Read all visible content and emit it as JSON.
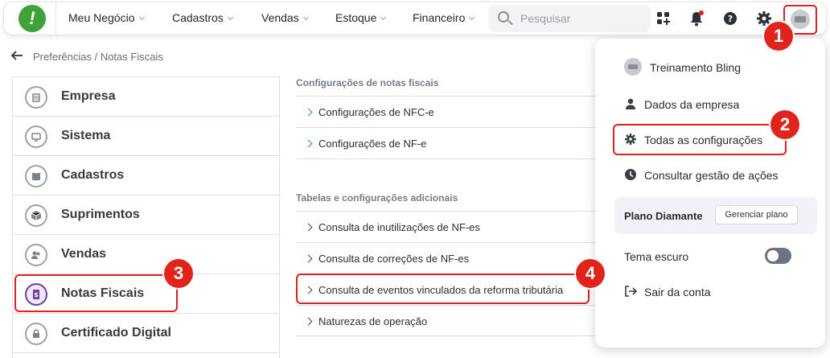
{
  "topbar": {
    "logo": "!",
    "nav": [
      {
        "label": "Meu Negócio"
      },
      {
        "label": "Cadastros"
      },
      {
        "label": "Vendas"
      },
      {
        "label": "Estoque"
      },
      {
        "label": "Financeiro"
      }
    ],
    "search_placeholder": "Pesquisar",
    "icons": [
      "apps-icon",
      "bell-icon",
      "help-icon",
      "gear-icon",
      "avatar"
    ],
    "notification_dot_color": "#e02020"
  },
  "breadcrumb": "Preferências / Notas Fiscais",
  "sidebar": {
    "items": [
      {
        "label": "Empresa",
        "icon": "building-icon"
      },
      {
        "label": "Sistema",
        "icon": "monitor-icon"
      },
      {
        "label": "Cadastros",
        "icon": "book-icon"
      },
      {
        "label": "Suprimentos",
        "icon": "box-icon"
      },
      {
        "label": "Vendas",
        "icon": "handshake-icon"
      },
      {
        "label": "Notas Fiscais",
        "icon": "invoice-icon",
        "active": true
      },
      {
        "label": "Certificado Digital",
        "icon": "lock-icon"
      }
    ]
  },
  "main": {
    "section1_title": "Configurações de notas fiscais",
    "section1_rows": [
      {
        "label": "Configurações de NFC-e"
      },
      {
        "label": "Configurações de NF-e"
      }
    ],
    "section2_title": "Tabelas e configurações adicionais",
    "section2_rows": [
      {
        "label": "Consulta de inutilizações de NF-es"
      },
      {
        "label": "Consulta de correções de NF-es"
      },
      {
        "label": "Consulta de eventos vinculados da reforma tributária"
      },
      {
        "label": "Naturezas de operação"
      }
    ]
  },
  "dropdown": {
    "account_name": "Treinamento Bling",
    "company_data": "Dados da empresa",
    "all_settings": "Todas as configurações",
    "actions_log": "Consultar gestão de ações",
    "plan_name": "Plano Diamante",
    "plan_button": "Gerenciar plano",
    "dark_theme": "Tema escuro",
    "dark_theme_on": false,
    "logout": "Sair da conta"
  },
  "callouts": [
    "1",
    "2",
    "3",
    "4"
  ],
  "colors": {
    "accent_green": "#3fa33a",
    "callout_red": "#e0241b",
    "active_purple": "#6b3fa6"
  }
}
